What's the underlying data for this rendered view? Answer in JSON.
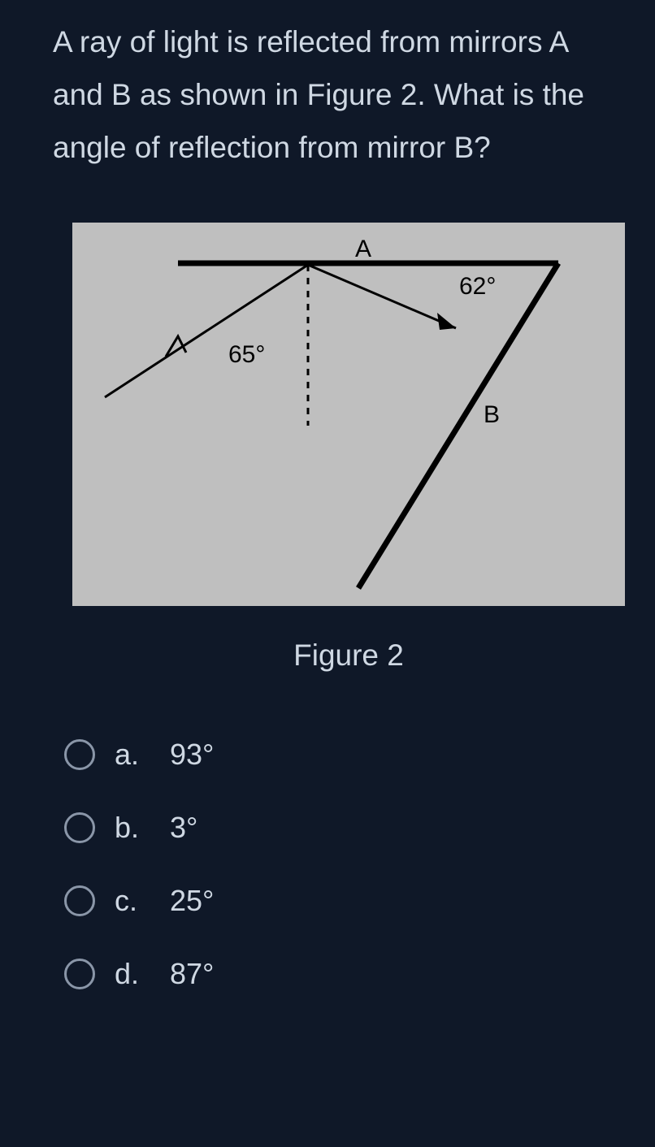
{
  "question": "A ray of light is reflected from mirrors A and B as shown in Figure 2. What is the angle of reflection from mirror B?",
  "figure": {
    "caption": "Figure 2",
    "labels": {
      "A": "A",
      "B": "B",
      "angle1": "65°",
      "angle2": "62°"
    }
  },
  "options": [
    {
      "letter": "a.",
      "text": "93°"
    },
    {
      "letter": "b.",
      "text": "3°"
    },
    {
      "letter": "c.",
      "text": "25°"
    },
    {
      "letter": "d.",
      "text": "87°"
    }
  ]
}
